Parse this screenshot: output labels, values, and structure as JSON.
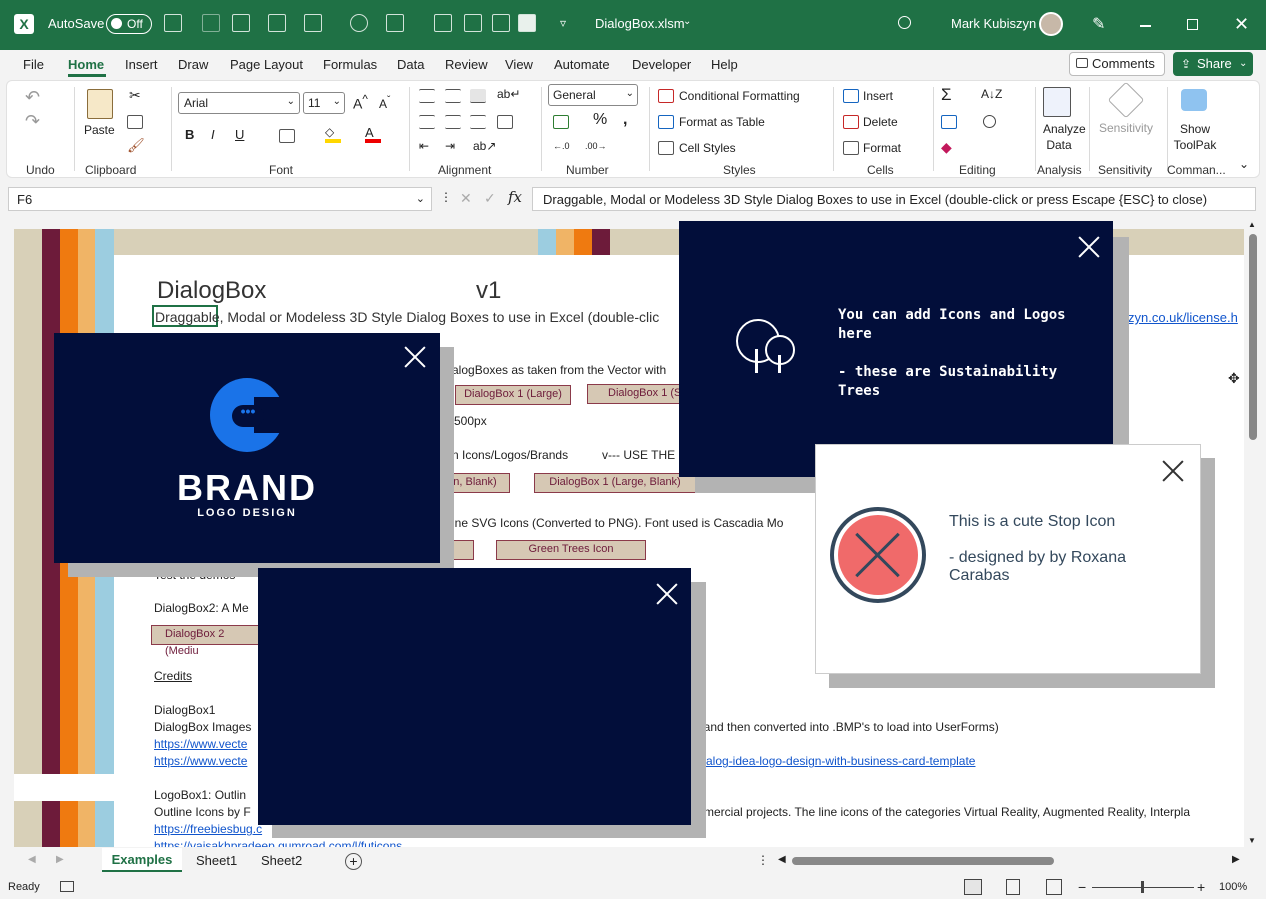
{
  "titlebar": {
    "autosave_label": "AutoSave",
    "autosave_state": "Off",
    "filename": "DialogBox.xlsm",
    "user": "Mark Kubiszyn"
  },
  "menu": [
    "File",
    "Home",
    "Insert",
    "Draw",
    "Page Layout",
    "Formulas",
    "Data",
    "Review",
    "View",
    "Automate",
    "Developer",
    "Help"
  ],
  "menu_active": "Home",
  "actions": {
    "comments": "Comments",
    "share": "Share"
  },
  "ribbon": {
    "groups": [
      "Undo",
      "Clipboard",
      "Font",
      "Alignment",
      "Number",
      "Styles",
      "Cells",
      "Editing",
      "Analysis",
      "Sensitivity",
      "Comman..."
    ],
    "paste": "Paste",
    "font_name": "Arial",
    "font_size": "11",
    "number_format": "General",
    "conditional_formatting": "Conditional Formatting",
    "format_as_table": "Format as Table",
    "cell_styles": "Cell Styles",
    "insert": "Insert",
    "delete": "Delete",
    "format": "Format",
    "analyze_data": "Analyze Data",
    "sensitivity": "Sensitivity",
    "show_toolpak": "Show ToolPak"
  },
  "formula_bar": {
    "name_box": "F6",
    "formula": "Draggable, Modal or Modeless 3D Style Dialog Boxes to use in Excel (double-click or press Escape {ESC} to close)"
  },
  "sheet": {
    "title": "DialogBox",
    "version": "v1",
    "subtitle": "Draggable, Modal or Modeless 3D Style Dialog Boxes to use in Excel (double-clic",
    "license_link": "zyn.co.uk/license.h",
    "row1": "alogBoxes as taken from the Vector with",
    "btn_large": "DialogBox 1 (Large)",
    "btn_small": "DialogBox 1 (S",
    "size_text": "500px",
    "row_icons": "n Icons/Logos/Brands",
    "use_the": "v--- USE THE",
    "btn_blank_a": "n, Blank)",
    "btn_blank_b": "DialogBox 1 (Large, Blank)",
    "row_svg": "ine SVG Icons (Converted to PNG).  Font used is Cascadia Mo",
    "btn_trees": "Green Trees Icon",
    "row_test": "Test the demos",
    "dialogbox2": "DialogBox2: A Me",
    "btn_medium": "DialogBox 2 (Mediu",
    "credits": "Credits",
    "db1": "DialogBox1",
    "db1_images": "DialogBox Images",
    "db1_images_rest": "G and then converted into .BMP's to load into UserForms)",
    "link_vecte1": "https://www.vecte",
    "link_vecte2": "https://www.vecte",
    "link_vecte2_rest": "alog-idea-logo-design-with-business-card-template",
    "logobox": "LogoBox1: Outlin",
    "outline_icons": "Outline Icons by F",
    "outline_rest": "mmercial projects. The line icons of the categories Virtual Reality, Augmented Reality, Interpla",
    "link_freebies": "https://freebiesbug.c",
    "link_gumroad": "https://vaisakhpradeep.gumroad.com/l/futicons"
  },
  "dialog_brand": {
    "brand": "BRAND",
    "tagline": "LOGO DESIGN"
  },
  "dialog_trees": {
    "line1": "You can add Icons and Logos here",
    "line2": "- these are Sustainability Trees"
  },
  "dialog_stop": {
    "line1": "This is a cute Stop Icon",
    "line2": "- designed by by Roxana Carabas"
  },
  "tabs": [
    "Examples",
    "Sheet1",
    "Sheet2"
  ],
  "tab_active": "Examples",
  "status": {
    "ready": "Ready",
    "zoom": "100%"
  },
  "colors": {
    "excel_green": "#1f7145",
    "dialog_navy": "#020e3a",
    "stop_red": "#f06a6a",
    "stop_ring": "#33485c",
    "btn_fill": "#d6c8b4",
    "btn_border": "#8b3a4a",
    "stripe_plum": "#6d1b3a",
    "stripe_orange": "#ef7a10",
    "stripe_peach": "#f0b466",
    "stripe_blue": "#9ccde0",
    "stripe_beige": "#d8d0b8",
    "brand_blue": "#1a73e8"
  }
}
